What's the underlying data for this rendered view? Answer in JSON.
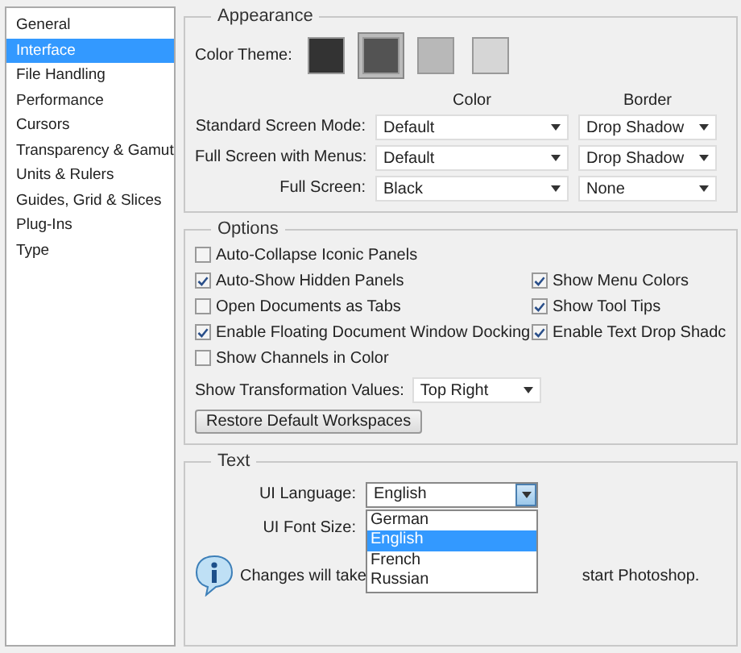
{
  "sidebar": {
    "items": [
      {
        "label": "General",
        "selected": false
      },
      {
        "label": "Interface",
        "selected": true
      },
      {
        "label": "File Handling",
        "selected": false
      },
      {
        "label": "Performance",
        "selected": false
      },
      {
        "label": "Cursors",
        "selected": false
      },
      {
        "label": "Transparency & Gamut",
        "selected": false
      },
      {
        "label": "Units & Rulers",
        "selected": false
      },
      {
        "label": "Guides, Grid & Slices",
        "selected": false
      },
      {
        "label": "Plug-Ins",
        "selected": false
      },
      {
        "label": "Type",
        "selected": false
      }
    ]
  },
  "appearance": {
    "title": "Appearance",
    "color_theme_label": "Color Theme:",
    "themes": [
      {
        "color": "#333333",
        "selected": false
      },
      {
        "color": "#535353",
        "selected": true
      },
      {
        "color": "#b8b8b8",
        "selected": false
      },
      {
        "color": "#d6d6d6",
        "selected": false
      }
    ],
    "columns": [
      "Color",
      "Border"
    ],
    "rows": [
      {
        "label": "Standard Screen Mode:",
        "color_value": "Default",
        "border": "Drop Shadow"
      },
      {
        "label": "Full Screen with Menus:",
        "color_value": "Default",
        "border": "Drop Shadow"
      },
      {
        "label": "Full Screen:",
        "color_value": "Black",
        "border": "None"
      }
    ]
  },
  "options": {
    "title": "Options",
    "checkbox_rows": [
      {
        "left": {
          "label": "Auto-Collapse Iconic Panels",
          "checked": false
        }
      },
      {
        "left": {
          "label": "Auto-Show Hidden Panels",
          "checked": true
        },
        "right": {
          "label": "Show Menu Colors",
          "checked": true
        }
      },
      {
        "left": {
          "label": "Open Documents as Tabs",
          "checked": false
        },
        "right": {
          "label": "Show Tool Tips",
          "checked": true
        }
      },
      {
        "left": {
          "label": "Enable Floating Document Window Docking",
          "checked": true
        },
        "right": {
          "label": "Enable Text Drop Shadc",
          "checked": true
        }
      },
      {
        "left": {
          "label": "Show Channels in Color",
          "checked": false
        }
      }
    ],
    "transformation_label": "Show Transformation Values:",
    "transformation_value": "Top Right",
    "restore_button": "Restore Default Workspaces"
  },
  "text": {
    "title": "Text",
    "ui_language_label": "UI Language:",
    "ui_language_value": "English",
    "language_options": [
      {
        "label": "German",
        "selected": false
      },
      {
        "label": "English",
        "selected": true
      },
      {
        "label": "French",
        "selected": false
      },
      {
        "label": "Russian",
        "selected": false
      }
    ],
    "ui_font_size_label": "UI Font Size:",
    "notice_parts": [
      "Changes will take",
      "start Photoshop."
    ]
  }
}
